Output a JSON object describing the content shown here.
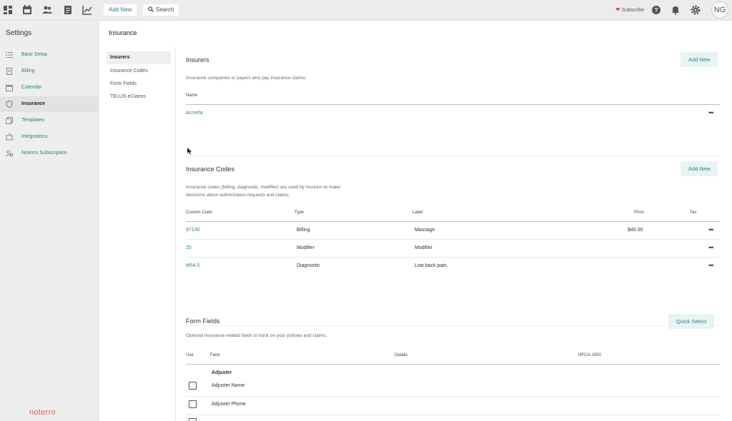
{
  "topbar": {
    "icons": [
      "dashboard-icon",
      "calendar-icon",
      "people-icon",
      "document-icon",
      "chart-icon"
    ],
    "add_new": "Add New",
    "search": "Search",
    "subscribe": "Subscribe",
    "avatar_initials": "NG"
  },
  "sidebar": {
    "title": "Settings",
    "items": [
      {
        "label": "Base Setup",
        "icon": "list-icon"
      },
      {
        "label": "Billing",
        "icon": "billing-icon"
      },
      {
        "label": "Calendar",
        "icon": "calendar-icon"
      },
      {
        "label": "Insurance",
        "icon": "shield-icon"
      },
      {
        "label": "Templates",
        "icon": "templates-icon"
      },
      {
        "label": "Integrations",
        "icon": "puzzle-icon"
      },
      {
        "label": "Noterro Subscription",
        "icon": "subscription-icon"
      }
    ],
    "logo": "noterro"
  },
  "main": {
    "title": "Insurance",
    "subnav": [
      "Insurers",
      "Insurance Codes",
      "Form Fields",
      "TELUS eClaims"
    ]
  },
  "insurers": {
    "title": "Insurers",
    "add_label": "Add New",
    "description": "Insurance companies or payers who pay insurance claims.",
    "column": "Name",
    "rows": [
      {
        "name": "Accerta"
      }
    ]
  },
  "codes": {
    "title": "Insurance Codes",
    "add_label": "Add New",
    "description_line1": "Insurance codes (billing, diagnostic, modifier) are used by Insurers to make",
    "description_line2": "decisions about authorization requests and claims.",
    "columns": [
      "Custom Code",
      "Type",
      "Label",
      "Price",
      "Tax"
    ],
    "rows": [
      {
        "code": "97140",
        "type": "Billing",
        "label": "Massage",
        "price": "$45.00"
      },
      {
        "code": "25",
        "type": "Modifier",
        "label": "Modifier",
        "price": ""
      },
      {
        "code": "M54.5",
        "type": "Diagnostic",
        "label": "Low back pain.",
        "price": ""
      }
    ]
  },
  "form_fields": {
    "title": "Form Fields",
    "quick_select": "Quick Select",
    "description": "Optional insurance related fields to track on your policies and claims.",
    "columns": [
      "Use",
      "Field",
      "Details",
      "HFCA-1500"
    ],
    "group": "Adjuster",
    "rows": [
      {
        "field": "Adjuster Name",
        "checked": false
      },
      {
        "field": "Adjuster Phone",
        "checked": false
      }
    ]
  },
  "row_menu": "•••",
  "colors": {
    "accent": "#2f7f86",
    "logo": "#d9604a",
    "heart": "#d9534f"
  }
}
